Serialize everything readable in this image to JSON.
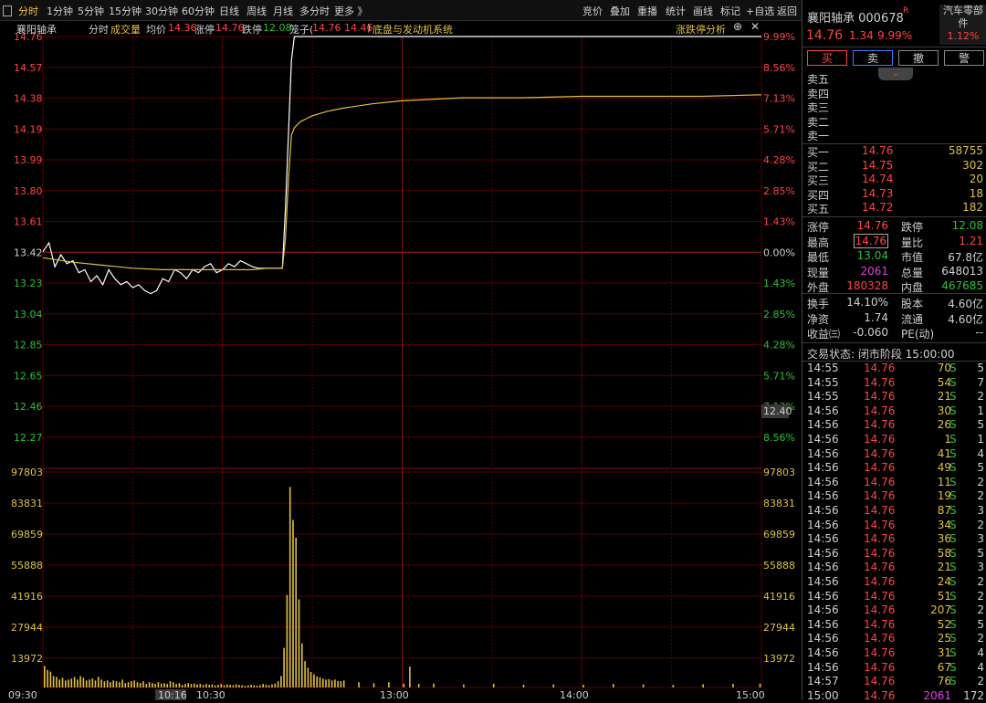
{
  "toolbar": {
    "tabs": [
      "分时",
      "1分钟",
      "5分钟",
      "15分钟",
      "30分钟",
      "60分钟",
      "日线",
      "周线",
      "月线",
      "多分时",
      "更多 》"
    ],
    "actions": [
      "竞价",
      "叠加",
      "重播",
      "统计",
      "画线",
      "标记",
      "+自选",
      "返回"
    ]
  },
  "info": {
    "name": "襄阳轴承",
    "mode": "分时",
    "vol_label": "成交量",
    "avg_label": "均价",
    "avg_value": "14.36",
    "limit_up_label": "涨停",
    "limit_up_value": "14.76",
    "limit_down_label": "跌停",
    "limit_down_value": "12.08",
    "cage_label": "笼子(",
    "cage_value": "14.76 14.46",
    "cage_close": ")",
    "concept": "底盘与发动机系统",
    "analysis": "涨跌停分析"
  },
  "axes": {
    "price_labels": [
      "14.76",
      "14.57",
      "14.38",
      "14.19",
      "13.99",
      "13.80",
      "13.61",
      "13.42",
      "13.23",
      "13.04",
      "12.85",
      "12.65",
      "12.46",
      "12.27"
    ],
    "pct_labels": [
      "9.99%",
      "8.56%",
      "7.13%",
      "5.71%",
      "4.28%",
      "2.85%",
      "1.43%",
      "0.00%",
      "1.43%",
      "2.85%",
      "4.28%",
      "5.71%",
      "7.13%",
      "8.56%"
    ],
    "pct_colors": [
      "#ff4545",
      "#ff4545",
      "#ff4545",
      "#ff4545",
      "#ff4545",
      "#ff4545",
      "#ff4545",
      "#d0d0d0",
      "#30c030",
      "#30c030",
      "#30c030",
      "#30c030",
      "#30c030",
      "#30c030"
    ],
    "volume_labels": [
      "97803",
      "83831",
      "69859",
      "55888",
      "41916",
      "27944",
      "13972"
    ],
    "time_labels": [
      "09:30",
      "10:16",
      "10:30",
      "13:00",
      "14:00",
      "15:00"
    ],
    "cursor_price": "12.40"
  },
  "chart_data": {
    "type": "line",
    "x_range": [
      "09:30",
      "15:00"
    ],
    "ylim": [
      12.08,
      14.76
    ],
    "series": [
      {
        "name": "price",
        "color": "#ffffff",
        "x": [
          0,
          2,
          4,
          6,
          8,
          10,
          12,
          14,
          16,
          18,
          20,
          22,
          24,
          26,
          28,
          30,
          32,
          34,
          36,
          38,
          40,
          42,
          44,
          46,
          48,
          50,
          52,
          54,
          56,
          58,
          60,
          62,
          64,
          66,
          68,
          70,
          72,
          74,
          76,
          78,
          80,
          81,
          82,
          83,
          84,
          85,
          86,
          87,
          88,
          90,
          100,
          120,
          150,
          180,
          210,
          240
        ],
        "y": [
          13.32,
          13.38,
          13.22,
          13.3,
          13.24,
          13.26,
          13.18,
          13.2,
          13.12,
          13.16,
          13.1,
          13.2,
          13.14,
          13.1,
          13.12,
          13.08,
          13.1,
          13.06,
          13.04,
          13.06,
          13.14,
          13.12,
          13.2,
          13.18,
          13.14,
          13.2,
          13.18,
          13.22,
          13.24,
          13.18,
          13.2,
          13.24,
          13.22,
          13.26,
          13.24,
          13.22,
          13.21,
          13.21,
          13.21,
          13.21,
          13.21,
          13.6,
          14.1,
          14.6,
          14.76,
          14.76,
          14.76,
          14.76,
          14.76,
          14.76,
          14.76,
          14.76,
          14.76,
          14.76,
          14.76,
          14.76
        ]
      },
      {
        "name": "avg",
        "color": "#e0c040",
        "x": [
          0,
          10,
          20,
          30,
          40,
          50,
          60,
          70,
          75,
          80,
          81,
          82,
          83,
          84,
          85,
          86,
          88,
          90,
          95,
          100,
          110,
          120,
          140,
          160,
          180,
          200,
          220,
          240
        ],
        "y": [
          13.28,
          13.25,
          13.23,
          13.21,
          13.2,
          13.2,
          13.2,
          13.2,
          13.21,
          13.21,
          13.4,
          13.8,
          14.1,
          14.15,
          14.17,
          14.19,
          14.21,
          14.23,
          14.26,
          14.28,
          14.31,
          14.33,
          14.35,
          14.35,
          14.36,
          14.36,
          14.36,
          14.37
        ]
      }
    ],
    "volume": {
      "ylim": [
        0,
        97803
      ],
      "bars": [
        [
          0,
          9800
        ],
        [
          1,
          8000
        ],
        [
          2,
          7200
        ],
        [
          3,
          5200
        ],
        [
          4,
          4800
        ],
        [
          5,
          3600
        ],
        [
          6,
          4400
        ],
        [
          7,
          3200
        ],
        [
          8,
          3600
        ],
        [
          9,
          4000
        ],
        [
          10,
          4800
        ],
        [
          11,
          3600
        ],
        [
          12,
          5200
        ],
        [
          13,
          4400
        ],
        [
          14,
          3200
        ],
        [
          15,
          3600
        ],
        [
          16,
          4000
        ],
        [
          17,
          3200
        ],
        [
          18,
          4800
        ],
        [
          19,
          3600
        ],
        [
          20,
          2800
        ],
        [
          21,
          3200
        ],
        [
          22,
          2400
        ],
        [
          23,
          3200
        ],
        [
          24,
          2800
        ],
        [
          25,
          2400
        ],
        [
          26,
          3600
        ],
        [
          27,
          2000
        ],
        [
          28,
          2400
        ],
        [
          29,
          2800
        ],
        [
          30,
          3200
        ],
        [
          31,
          2400
        ],
        [
          32,
          2000
        ],
        [
          33,
          2800
        ],
        [
          34,
          1600
        ],
        [
          35,
          2400
        ],
        [
          36,
          2000
        ],
        [
          37,
          1600
        ],
        [
          38,
          2400
        ],
        [
          39,
          1800
        ],
        [
          40,
          2000
        ],
        [
          41,
          1600
        ],
        [
          42,
          2800
        ],
        [
          43,
          2400
        ],
        [
          44,
          1600
        ],
        [
          45,
          2000
        ],
        [
          46,
          1200
        ],
        [
          47,
          1600
        ],
        [
          48,
          2000
        ],
        [
          49,
          1600
        ],
        [
          50,
          1800
        ],
        [
          51,
          1400
        ],
        [
          52,
          1600
        ],
        [
          53,
          1200
        ],
        [
          54,
          1600
        ],
        [
          55,
          1200
        ],
        [
          56,
          1400
        ],
        [
          57,
          1000
        ],
        [
          58,
          1200
        ],
        [
          59,
          1600
        ],
        [
          60,
          1000
        ],
        [
          61,
          1400
        ],
        [
          62,
          1200
        ],
        [
          63,
          1000
        ],
        [
          64,
          1400
        ],
        [
          65,
          1200
        ],
        [
          66,
          1000
        ],
        [
          67,
          800
        ],
        [
          68,
          1000
        ],
        [
          69,
          1200
        ],
        [
          70,
          1000
        ],
        [
          71,
          800
        ],
        [
          72,
          1000
        ],
        [
          73,
          1600
        ],
        [
          74,
          1200
        ],
        [
          75,
          1000
        ],
        [
          76,
          1400
        ],
        [
          77,
          1800
        ],
        [
          78,
          2800
        ],
        [
          79,
          5200
        ],
        [
          80,
          18000
        ],
        [
          81,
          42000
        ],
        [
          82,
          91000
        ],
        [
          83,
          76000
        ],
        [
          84,
          68000
        ],
        [
          85,
          40000
        ],
        [
          86,
          20000
        ],
        [
          87,
          12000
        ],
        [
          88,
          9000
        ],
        [
          89,
          7000
        ],
        [
          90,
          6000
        ],
        [
          91,
          5000
        ],
        [
          92,
          4600
        ],
        [
          93,
          4000
        ],
        [
          94,
          3600
        ],
        [
          95,
          3800
        ],
        [
          96,
          3200
        ],
        [
          97,
          3600
        ],
        [
          98,
          3000
        ],
        [
          99,
          2800
        ],
        [
          100,
          3200
        ],
        [
          105,
          2400
        ],
        [
          110,
          2000
        ],
        [
          115,
          2400
        ],
        [
          120,
          1800
        ],
        [
          122,
          9500
        ],
        [
          125,
          1600
        ],
        [
          130,
          1800
        ],
        [
          140,
          1400
        ],
        [
          150,
          1600
        ],
        [
          160,
          1200
        ],
        [
          170,
          1400
        ],
        [
          180,
          1200
        ],
        [
          190,
          1600
        ],
        [
          200,
          1400
        ],
        [
          210,
          1200
        ],
        [
          220,
          1400
        ],
        [
          230,
          1600
        ],
        [
          239,
          1800
        ]
      ]
    }
  },
  "panel": {
    "title": "襄阳轴承 000678",
    "r_badge": "R",
    "price": "14.76",
    "change": "1.34",
    "pct": "9.99%",
    "sector_line1": "汽车零部",
    "sector_line2": "件",
    "sector_pct": "1.12%",
    "buttons": [
      "买",
      "卖",
      "撤",
      "警"
    ],
    "sells": [
      {
        "label": "卖五",
        "price": "",
        "vol": ""
      },
      {
        "label": "卖四",
        "price": "",
        "vol": ""
      },
      {
        "label": "卖三",
        "price": "",
        "vol": ""
      },
      {
        "label": "卖二",
        "price": "",
        "vol": ""
      },
      {
        "label": "卖一",
        "price": "",
        "vol": ""
      }
    ],
    "buys": [
      {
        "label": "买一",
        "price": "14.76",
        "vol": "58755"
      },
      {
        "label": "买二",
        "price": "14.75",
        "vol": "302"
      },
      {
        "label": "买三",
        "price": "14.74",
        "vol": "20"
      },
      {
        "label": "买四",
        "price": "14.73",
        "vol": "18"
      },
      {
        "label": "买五",
        "price": "14.72",
        "vol": "182"
      }
    ],
    "stats": [
      {
        "l1": "涨停",
        "v1": "14.76",
        "c1": "#ff4545",
        "l2": "跌停",
        "v2": "12.08",
        "c2": "#30c030"
      },
      {
        "l1": "最高",
        "v1": "14.76",
        "c1": "#ff4545",
        "l2": "量比",
        "v2": "1.21",
        "c2": "#ff4545"
      },
      {
        "l1": "最低",
        "v1": "13.04",
        "c1": "#30c030",
        "l2": "市值",
        "v2": "67.8亿",
        "c2": "#d0d0d0"
      },
      {
        "l1": "现量",
        "v1": "2061",
        "c1": "#e040e0",
        "l2": "总量",
        "v2": "648013",
        "c2": "#d0d0d0"
      },
      {
        "l1": "外盘",
        "v1": "180328",
        "c1": "#ff4545",
        "l2": "内盘",
        "v2": "467685",
        "c2": "#30c030"
      }
    ],
    "stats2": [
      {
        "l1": "换手",
        "v1": "14.10%",
        "l2": "股本",
        "v2": "4.60亿"
      },
      {
        "l1": "净资",
        "v1": "1.74",
        "l2": "流通",
        "v2": "4.60亿"
      },
      {
        "l1": "收益㈢",
        "v1": "-0.060",
        "l2": "PE(动)",
        "v2": "--"
      }
    ],
    "status_label": "交易状态: 闭市阶段 15:00:00",
    "ticks": [
      {
        "t": "14:55",
        "p": "14.76",
        "v": "70",
        "s": "S",
        "n": "5"
      },
      {
        "t": "14:55",
        "p": "14.76",
        "v": "54",
        "s": "S",
        "n": "7"
      },
      {
        "t": "14:55",
        "p": "14.76",
        "v": "21",
        "s": "S",
        "n": "2"
      },
      {
        "t": "14:56",
        "p": "14.76",
        "v": "30",
        "s": "S",
        "n": "1"
      },
      {
        "t": "14:56",
        "p": "14.76",
        "v": "26",
        "s": "S",
        "n": "5"
      },
      {
        "t": "14:56",
        "p": "14.76",
        "v": "1",
        "s": "S",
        "n": "1"
      },
      {
        "t": "14:56",
        "p": "14.76",
        "v": "41",
        "s": "S",
        "n": "4"
      },
      {
        "t": "14:56",
        "p": "14.76",
        "v": "49",
        "s": "S",
        "n": "5"
      },
      {
        "t": "14:56",
        "p": "14.76",
        "v": "11",
        "s": "S",
        "n": "2"
      },
      {
        "t": "14:56",
        "p": "14.76",
        "v": "19",
        "s": "S",
        "n": "2"
      },
      {
        "t": "14:56",
        "p": "14.76",
        "v": "87",
        "s": "S",
        "n": "3"
      },
      {
        "t": "14:56",
        "p": "14.76",
        "v": "34",
        "s": "S",
        "n": "2"
      },
      {
        "t": "14:56",
        "p": "14.76",
        "v": "36",
        "s": "S",
        "n": "3"
      },
      {
        "t": "14:56",
        "p": "14.76",
        "v": "58",
        "s": "S",
        "n": "5"
      },
      {
        "t": "14:56",
        "p": "14.76",
        "v": "21",
        "s": "S",
        "n": "3"
      },
      {
        "t": "14:56",
        "p": "14.76",
        "v": "24",
        "s": "S",
        "n": "2"
      },
      {
        "t": "14:56",
        "p": "14.76",
        "v": "51",
        "s": "S",
        "n": "2"
      },
      {
        "t": "14:56",
        "p": "14.76",
        "v": "207",
        "s": "S",
        "n": "2"
      },
      {
        "t": "14:56",
        "p": "14.76",
        "v": "52",
        "s": "S",
        "n": "5"
      },
      {
        "t": "14:56",
        "p": "14.76",
        "v": "25",
        "s": "S",
        "n": "2"
      },
      {
        "t": "14:56",
        "p": "14.76",
        "v": "31",
        "s": "S",
        "n": "4"
      },
      {
        "t": "14:56",
        "p": "14.76",
        "v": "67",
        "s": "S",
        "n": "4"
      },
      {
        "t": "14:57",
        "p": "14.76",
        "v": "76",
        "s": "S",
        "n": "2"
      },
      {
        "t": "15:00",
        "p": "14.76",
        "v": "2061",
        "s": "",
        "n": "172"
      }
    ]
  }
}
